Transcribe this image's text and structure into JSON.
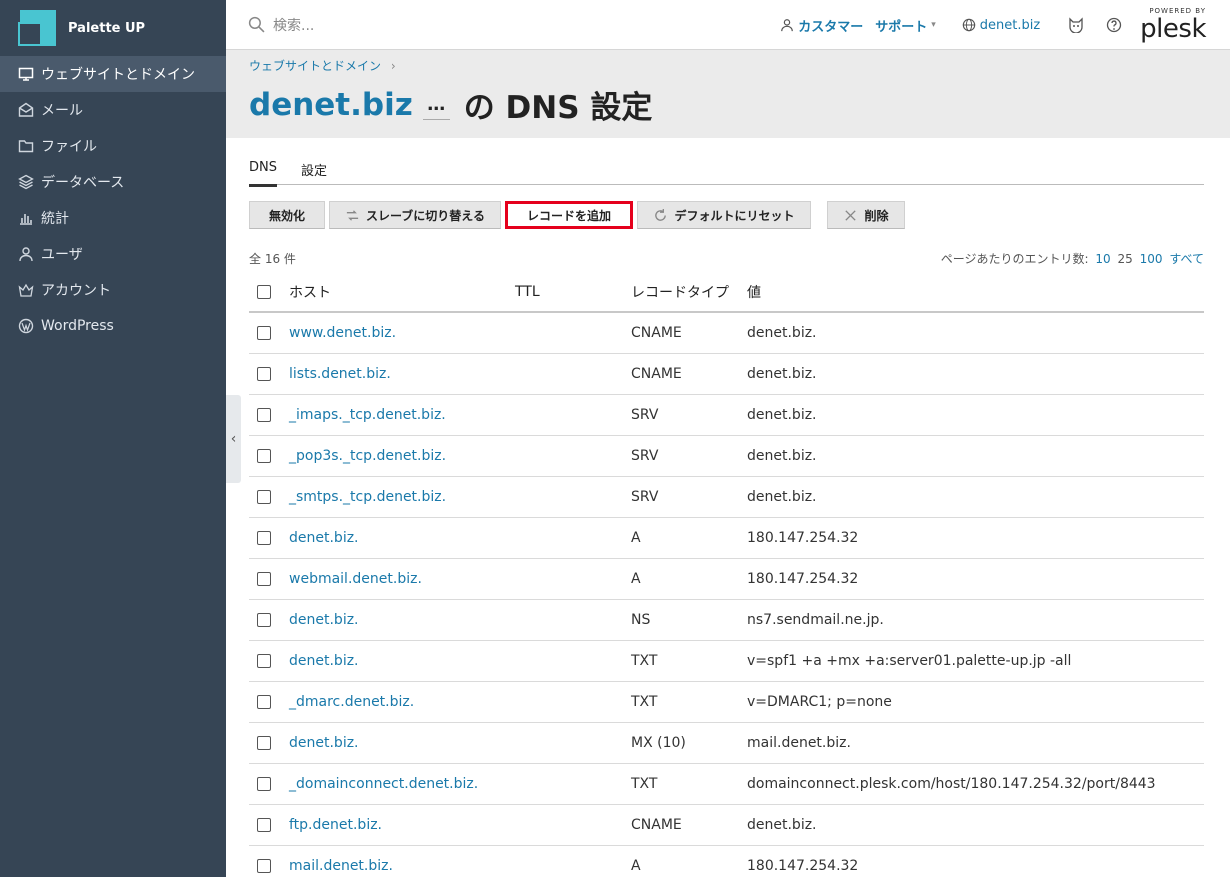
{
  "brand": {
    "name": "Palette UP"
  },
  "sidebar": {
    "items": [
      {
        "label": "ウェブサイトとドメイン",
        "icon": "monitor-icon",
        "active": true
      },
      {
        "label": "メール",
        "icon": "mail-icon"
      },
      {
        "label": "ファイル",
        "icon": "folder-icon"
      },
      {
        "label": "データベース",
        "icon": "database-icon"
      },
      {
        "label": "統計",
        "icon": "bar-chart-icon"
      },
      {
        "label": "ユーザ",
        "icon": "user-icon"
      },
      {
        "label": "アカウント",
        "icon": "crown-icon"
      },
      {
        "label": "WordPress",
        "icon": "wordpress-icon"
      }
    ]
  },
  "header": {
    "search_placeholder": "検索...",
    "customer_label": "カスタマー",
    "support_label": "サポート",
    "domain_label": "denet.biz",
    "plesk_powered": "POWERED BY",
    "plesk_name": "plesk"
  },
  "breadcrumb": {
    "label": "ウェブサイトとドメイン",
    "sep": "›"
  },
  "title": {
    "domain": "denet.biz",
    "more": "…",
    "suffix": "の DNS 設定"
  },
  "tabs": [
    {
      "label": "DNS",
      "active": true
    },
    {
      "label": "設定"
    }
  ],
  "toolbar": {
    "disable": "無効化",
    "switch_slave": "スレーブに切り替える",
    "add_record": "レコードを追加",
    "reset_default": "デフォルトにリセット",
    "delete": "削除"
  },
  "list": {
    "count": "全 16 件",
    "perpage_label": "ページあたりのエントリ数:",
    "perpage_options": [
      "10",
      "25",
      "100",
      "すべて"
    ],
    "columns": {
      "host": "ホスト",
      "ttl": "TTL",
      "type": "レコードタイプ",
      "value": "値"
    },
    "rows": [
      {
        "host": "www.denet.biz.",
        "ttl": "",
        "type": "CNAME",
        "value": "denet.biz."
      },
      {
        "host": "lists.denet.biz.",
        "ttl": "",
        "type": "CNAME",
        "value": "denet.biz."
      },
      {
        "host": "_imaps._tcp.denet.biz.",
        "ttl": "",
        "type": "SRV",
        "value": "denet.biz."
      },
      {
        "host": "_pop3s._tcp.denet.biz.",
        "ttl": "",
        "type": "SRV",
        "value": "denet.biz."
      },
      {
        "host": "_smtps._tcp.denet.biz.",
        "ttl": "",
        "type": "SRV",
        "value": "denet.biz."
      },
      {
        "host": "denet.biz.",
        "ttl": "",
        "type": "A",
        "value": "180.147.254.32"
      },
      {
        "host": "webmail.denet.biz.",
        "ttl": "",
        "type": "A",
        "value": "180.147.254.32"
      },
      {
        "host": "denet.biz.",
        "ttl": "",
        "type": "NS",
        "value": "ns7.sendmail.ne.jp."
      },
      {
        "host": "denet.biz.",
        "ttl": "",
        "type": "TXT",
        "value": "v=spf1 +a +mx +a:server01.palette-up.jp -all"
      },
      {
        "host": "_dmarc.denet.biz.",
        "ttl": "",
        "type": "TXT",
        "value": "v=DMARC1; p=none"
      },
      {
        "host": "denet.biz.",
        "ttl": "",
        "type": "MX (10)",
        "value": "mail.denet.biz."
      },
      {
        "host": "_domainconnect.denet.biz.",
        "ttl": "",
        "type": "TXT",
        "value": "domainconnect.plesk.com/host/180.147.254.32/port/8443"
      },
      {
        "host": "ftp.denet.biz.",
        "ttl": "",
        "type": "CNAME",
        "value": "denet.biz."
      },
      {
        "host": "mail.denet.biz.",
        "ttl": "",
        "type": "A",
        "value": "180.147.254.32"
      }
    ]
  },
  "colors": {
    "sidebar": "#364555",
    "link": "#1a79aa",
    "highlight": "#e5001c",
    "accent": "#49c5d1"
  }
}
